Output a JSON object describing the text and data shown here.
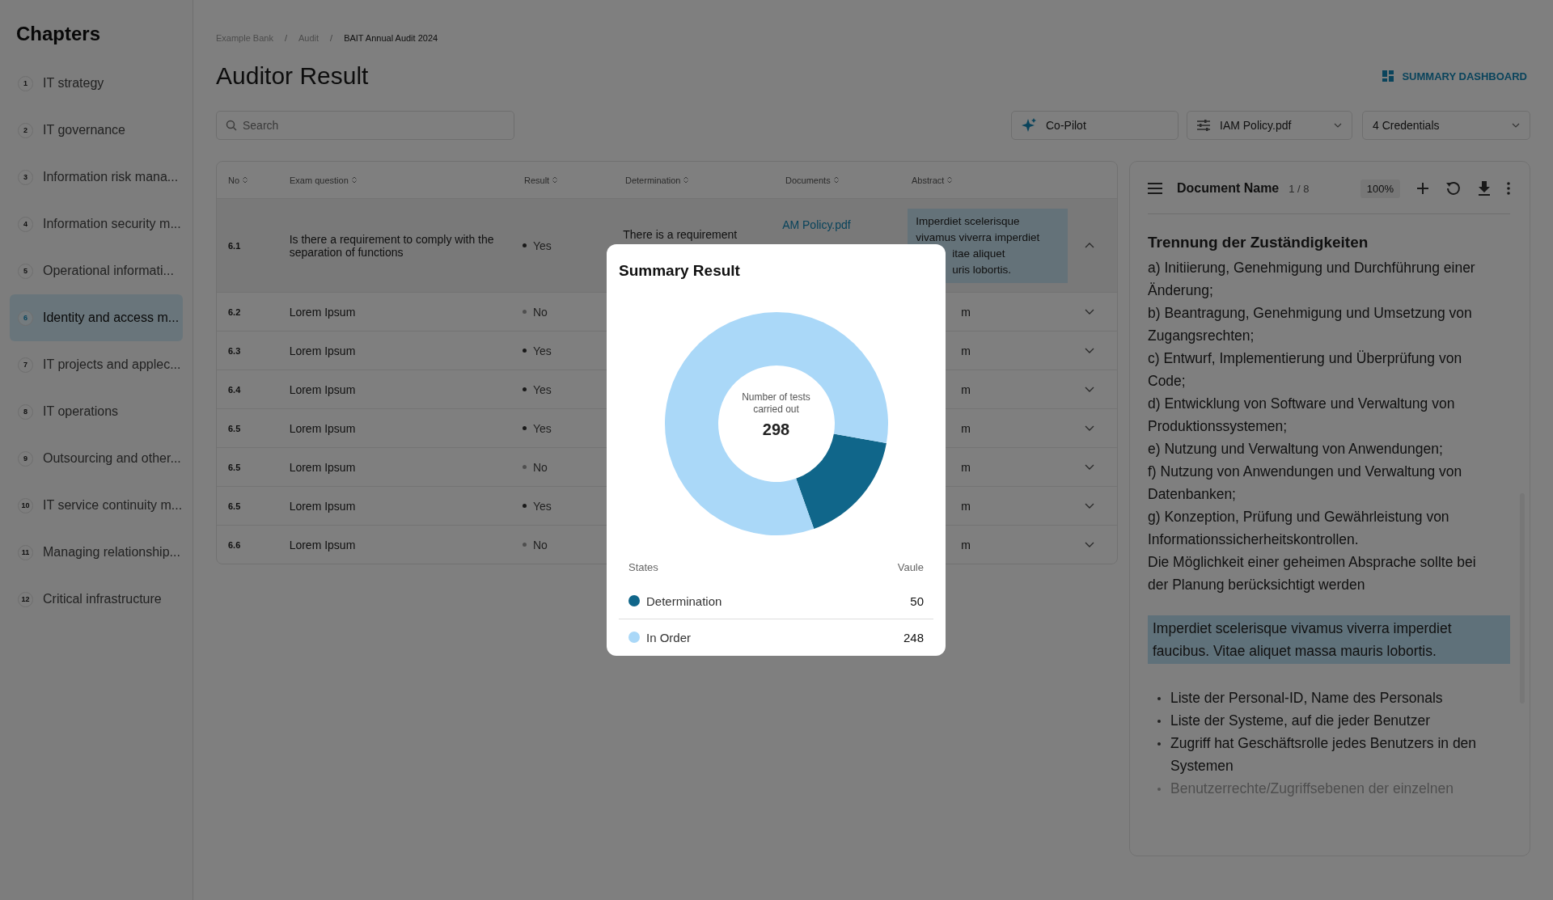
{
  "sidebar": {
    "title": "Chapters",
    "items": [
      {
        "number": "1",
        "label": "IT strategy",
        "selected": false
      },
      {
        "number": "2",
        "label": "IT governance",
        "selected": false
      },
      {
        "number": "3",
        "label": "Information risk mana...",
        "selected": false
      },
      {
        "number": "4",
        "label": "Information security m...",
        "selected": false
      },
      {
        "number": "5",
        "label": "Operational informati...",
        "selected": false
      },
      {
        "number": "6",
        "label": "Identity and access m...",
        "selected": true
      },
      {
        "number": "7",
        "label": "IT projects and applec...",
        "selected": false
      },
      {
        "number": "8",
        "label": "IT operations",
        "selected": false
      },
      {
        "number": "9",
        "label": "Outsourcing and other...",
        "selected": false
      },
      {
        "number": "10",
        "label": "IT service continuity m...",
        "selected": false
      },
      {
        "number": "11",
        "label": "Managing relationship...",
        "selected": false
      },
      {
        "number": "12",
        "label": "Critical infrastructure",
        "selected": false
      }
    ]
  },
  "breadcrumb_separator": "/",
  "breadcrumb": [
    {
      "label": "Example Bank",
      "current": false
    },
    {
      "label": "Audit",
      "current": false
    },
    {
      "label": "BAIT Annual Audit 2024",
      "current": true
    }
  ],
  "page_title": "Auditor Result",
  "summary_button": "SUMMARY DASHBOARD",
  "search": {
    "placeholder": "Search"
  },
  "copilot_button": "Co-Pilot",
  "document_select": "IAM Policy.pdf",
  "credentials_select": "4 Credentials",
  "table": {
    "columns": [
      "No",
      "Exam question",
      "Result",
      "Determination",
      "Documents",
      "Abstract"
    ],
    "rows": [
      {
        "no": "6.1",
        "question": "Is there a requirement to comply with the separation of functions",
        "result": "Yes",
        "kind": "positive",
        "determination": "There is a requirement",
        "documents": [
          "AM Policy.pdf"
        ],
        "abstract": [
          "Imperdiet scelerisque",
          "vivamus viverra imperdiet",
          "itae aliquet",
          "uris lobortis."
        ],
        "expanded": true
      },
      {
        "no": "6.2",
        "question": "Lorem Ipsum",
        "result": "No",
        "kind": "negative",
        "abstract": [
          "m"
        ],
        "expanded": false
      },
      {
        "no": "6.3",
        "question": "Lorem Ipsum",
        "result": "Yes",
        "kind": "positive",
        "abstract": [
          "m"
        ],
        "expanded": false
      },
      {
        "no": "6.4",
        "question": "Lorem Ipsum",
        "result": "Yes",
        "kind": "positive",
        "abstract": [
          "m"
        ],
        "expanded": false
      },
      {
        "no": "6.5",
        "question": "Lorem Ipsum",
        "result": "Yes",
        "kind": "positive",
        "abstract": [
          "m"
        ],
        "expanded": false
      },
      {
        "no": "6.5",
        "question": "Lorem Ipsum",
        "result": "No",
        "kind": "negative",
        "abstract": [
          "m"
        ],
        "expanded": false
      },
      {
        "no": "6.5",
        "question": "Lorem Ipsum",
        "result": "Yes",
        "kind": "positive",
        "abstract": [
          "m"
        ],
        "expanded": false
      },
      {
        "no": "6.6",
        "question": "Lorem Ipsum",
        "result": "No",
        "kind": "negative",
        "abstract": [
          "m"
        ],
        "expanded": false
      }
    ]
  },
  "document_viewer": {
    "title": "Document Name",
    "page": "1 / 8",
    "zoom": "100%",
    "heading": "Trennung der Zuständigkeiten",
    "paragraphs": [
      "a) Initiierung, Genehmigung und Durchführung einer Änderung;",
      "b) Beantragung, Genehmigung und Umsetzung von Zugangsrechten;",
      "c) Entwurf, Implementierung und Überprüfung von Code;",
      "d) Entwicklung von Software und Verwaltung von Produktionssystemen;",
      "e) Nutzung und Verwaltung von Anwendungen;",
      "f) Nutzung von Anwendungen und Verwaltung von Datenbanken;",
      "g) Konzeption, Prüfung und Gewährleistung von Informationssicherheitskontrollen.",
      "Die Möglichkeit einer geheimen Absprache sollte bei der Planung berücksichtigt werden"
    ],
    "highlight": "Imperdiet scelerisque vivamus viverra imperdiet faucibus. Vitae aliquet massa mauris lobortis.",
    "bullets": [
      "Liste der Personal-ID, Name des Personals",
      "Liste der Systeme, auf die jeder Benutzer",
      "Zugriff hat Geschäftsrolle jedes Benutzers in den Systemen",
      "Benutzerrechte/Zugriffsebenen der einzelnen"
    ]
  },
  "modal": {
    "title": "Summary Result",
    "center_label": "Number of tests carried out",
    "center_value": "298",
    "chart_data": {
      "type": "donut",
      "categories": [
        "Determination",
        "In Order"
      ],
      "values": [
        16.78,
        83.22
      ]
    },
    "legend_header": [
      "States",
      "Vaule"
    ],
    "legend": [
      {
        "value": "50",
        "color": "#10668a"
      },
      {
        "value": "248",
        "color": "#aad8f8"
      }
    ]
  }
}
